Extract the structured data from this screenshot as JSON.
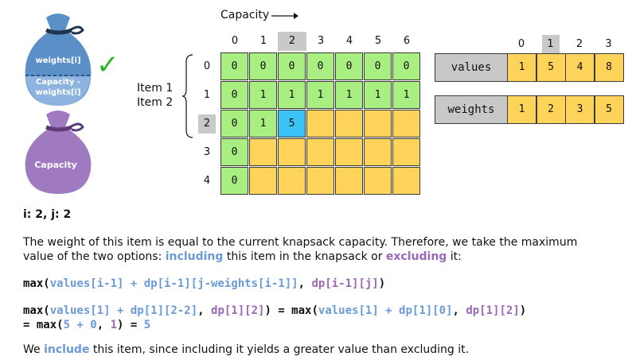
{
  "header": {
    "capacity_label": "Capacity"
  },
  "bags": {
    "top_label": "weights[i]",
    "top_sub_label": "Capacity -\nweights[i]",
    "bottom_label": "Capacity",
    "check": "✓"
  },
  "item_labels": [
    "Item 1",
    "Item 2"
  ],
  "grid": {
    "cols": [
      "0",
      "1",
      "2",
      "3",
      "4",
      "5",
      "6"
    ],
    "rows": [
      "0",
      "1",
      "2",
      "3",
      "4"
    ],
    "highlight_col": 2,
    "highlight_row": 2,
    "cells": [
      [
        "0",
        "0",
        "0",
        "0",
        "0",
        "0",
        "0"
      ],
      [
        "0",
        "1",
        "1",
        "1",
        "1",
        "1",
        "1"
      ],
      [
        "0",
        "1",
        "5",
        "",
        "",
        "",
        ""
      ],
      [
        "0",
        "",
        "",
        "",
        "",
        "",
        ""
      ],
      [
        "0",
        "",
        "",
        "",
        "",
        "",
        ""
      ]
    ],
    "colors": [
      [
        "g",
        "g",
        "g",
        "g",
        "g",
        "g",
        "g"
      ],
      [
        "g",
        "g",
        "g",
        "g",
        "g",
        "g",
        "g"
      ],
      [
        "g",
        "g",
        "b",
        "y",
        "y",
        "y",
        "y"
      ],
      [
        "g",
        "y",
        "y",
        "y",
        "y",
        "y",
        "y"
      ],
      [
        "g",
        "y",
        "y",
        "y",
        "y",
        "y",
        "y"
      ]
    ]
  },
  "vectors": {
    "index_cols": [
      "0",
      "1",
      "2",
      "3"
    ],
    "highlight_col": 1,
    "values_label": "values",
    "values": [
      "1",
      "5",
      "4",
      "8"
    ],
    "weights_label": "weights",
    "weights": [
      "1",
      "2",
      "3",
      "5"
    ]
  },
  "text": {
    "ij": "i: 2, j: 2",
    "para1_a": "The weight of this item is equal to the current knapsack capacity. Therefore, we take the maximum",
    "para1_b_1": "value of the two options: ",
    "para1_b_including": "including",
    "para1_b_2": " this item in the knapsack or ",
    "para1_b_excluding": "excluding",
    "para1_b_3": " it:",
    "f1_max": "max(",
    "f1_blue": "values[i-1] + dp[i-1][j-weights[i-1]]",
    "f1_comma": ", ",
    "f1_purple": "dp[i-1][j]",
    "f1_close": ")",
    "f2_max": "max(",
    "f2_blue": "values[1] + dp[1][2-2]",
    "f2_comma": ", ",
    "f2_purple": "dp[1][2]",
    "f2_eq": ") = max(",
    "f2_blue2": "values[1] + dp[1][0]",
    "f2_comma2": ", ",
    "f2_purple2": "dp[1][2]",
    "f2_close": ")",
    "f3_eq": "= max(",
    "f3_blue": "5 + 0",
    "f3_comma": ", ",
    "f3_purple": "1",
    "f3_close": ") = ",
    "f3_result": "5",
    "final_1": "We ",
    "final_include": "include",
    "final_2": " this item, since including it yields a greater value than excluding it."
  },
  "colors": {
    "green": "#a8ee80",
    "yellow": "#fdd35a",
    "blue_cell": "#3cc3f5",
    "blue_text": "#6a9bd8",
    "purple_text": "#9b68b8",
    "bag_blue": "#5b8fc7",
    "bag_purple": "#a07ac0",
    "check_green": "#2db52d"
  }
}
